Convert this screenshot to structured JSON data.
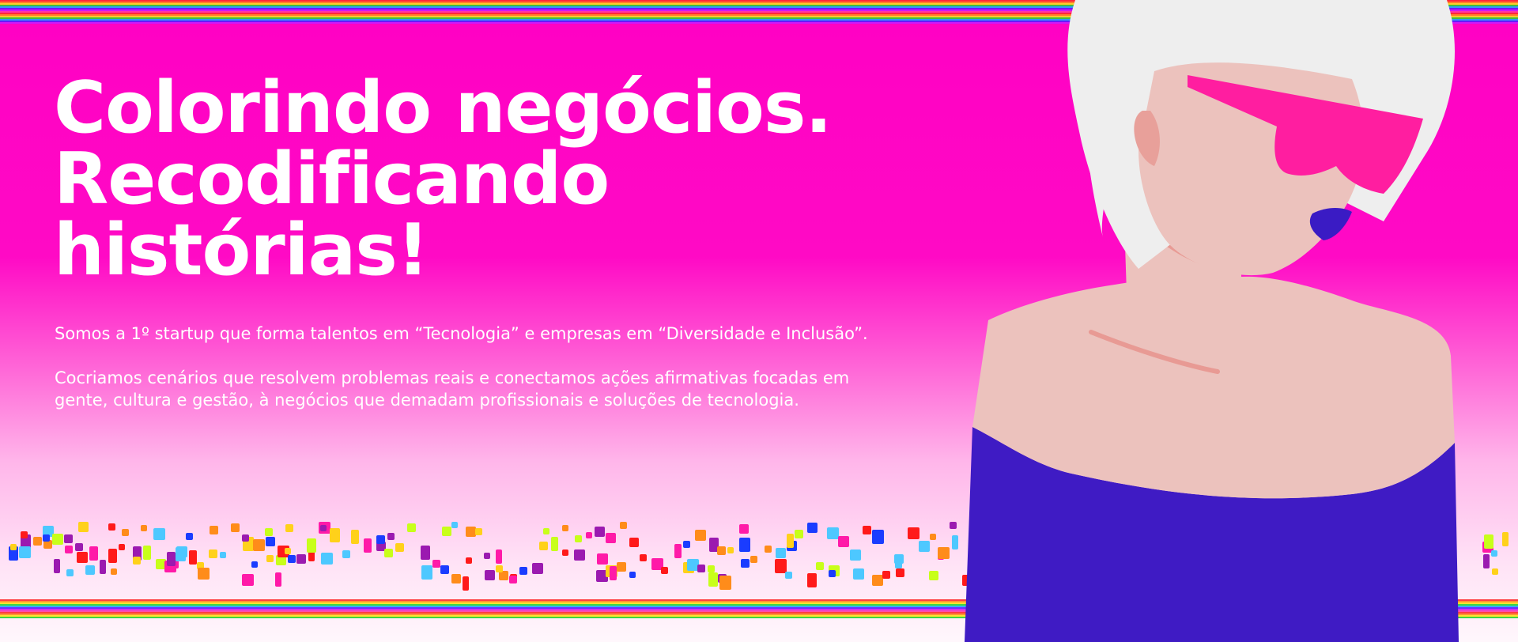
{
  "hero": {
    "line1": "Colorindo negócios.",
    "line2": "Recodificando",
    "line3": "histórias!"
  },
  "intro": {
    "paragraph1": "Somos a 1º startup que forma talentos em “Tecnologia” e empresas em “Diversidade e Inclusão”.",
    "paragraph2": "Cocriamos cenários que resolvem problemas reais e conectamos ações afirmativas focadas em gente, cultura e gestão, à negócios que demadam profissionais e soluções de tecnologia."
  },
  "colors": {
    "background_top": "#ff00c4",
    "confetti": [
      "#ff1a1a",
      "#ff8c1a",
      "#ffd11a",
      "#c8ff1a",
      "#1a3cff",
      "#9b1ab0",
      "#ff1aa8",
      "#4dc8ff"
    ],
    "shirt": "#3f1bc4",
    "glasses": "#ff1ea0",
    "hair": "#eeeeee",
    "skin": "#ecc2bd",
    "lips": "#3a1bc4"
  },
  "icons": [
    "woman-illustration"
  ]
}
